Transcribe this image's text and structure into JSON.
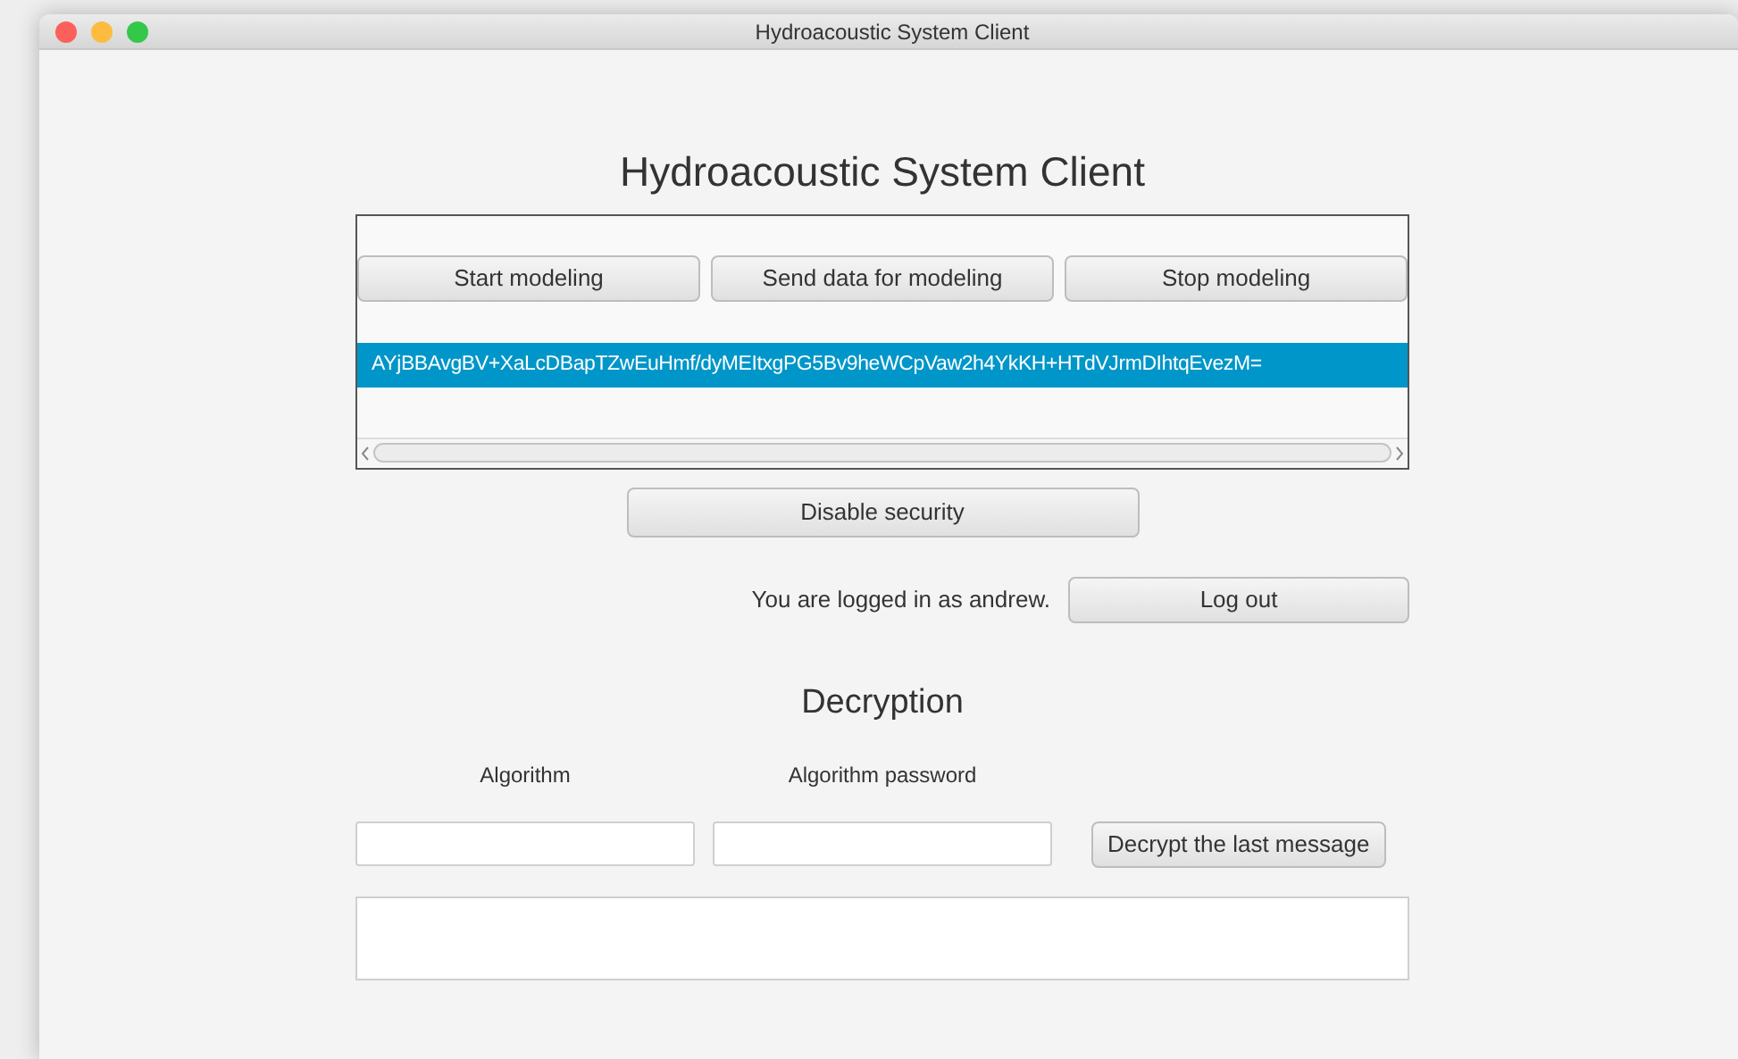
{
  "window": {
    "title": "Hydroacoustic System Client"
  },
  "heading": "Hydroacoustic System Client",
  "modeling_buttons": [
    "Start modeling",
    "Send data for modeling",
    "Stop modeling"
  ],
  "messages": [
    {
      "text": "AYjBBAvgBV+XaLcDBapTZwEuHmf/dyMEItxgPG5Bv9heWCpVaw2h4YkKH+HTdVJrmDIhtqEvezM=",
      "selected": true
    }
  ],
  "security_button": "Disable security",
  "login": {
    "status": "You are logged in as andrew.",
    "button": "Log out"
  },
  "decryption": {
    "title": "Decryption",
    "fields": [
      {
        "label": "Algorithm"
      },
      {
        "label": "Algorithm password"
      }
    ],
    "button": "Decrypt the last message"
  }
}
